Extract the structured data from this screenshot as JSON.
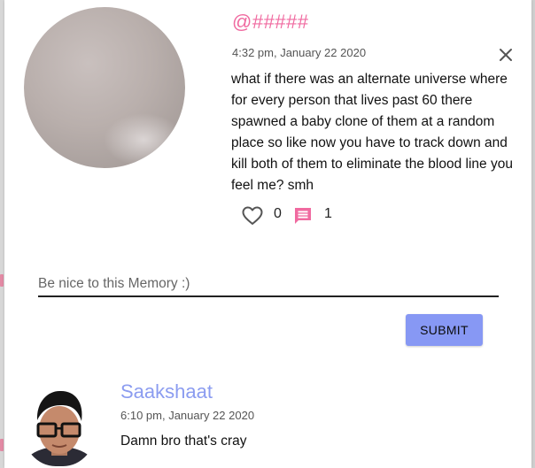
{
  "post": {
    "handle": "@#####",
    "timestamp": "4:32 pm, January 22 2020",
    "message": "what if there was an alternate universe where for every person that lives past 60 there spawned a baby clone of them at a random place so like now you have to track down and kill both of them to eliminate the blood line you feel me? smh",
    "like_count": "0",
    "comment_count": "1"
  },
  "comment_form": {
    "placeholder": "Be nice to this Memory :)",
    "submit_label": "SUBMIT"
  },
  "comments": [
    {
      "author": "Saakshaat",
      "timestamp": "6:10 pm, January 22 2020",
      "text": "Damn bro that's cray"
    }
  ],
  "colors": {
    "handle": "#f06aa0",
    "comment_icon": "#f06aa0",
    "submit_button": "#8798f4",
    "comment_author": "#8b9cf0"
  },
  "icons": {
    "close": "close-icon",
    "like": "heart-icon",
    "comments": "comment-icon"
  }
}
